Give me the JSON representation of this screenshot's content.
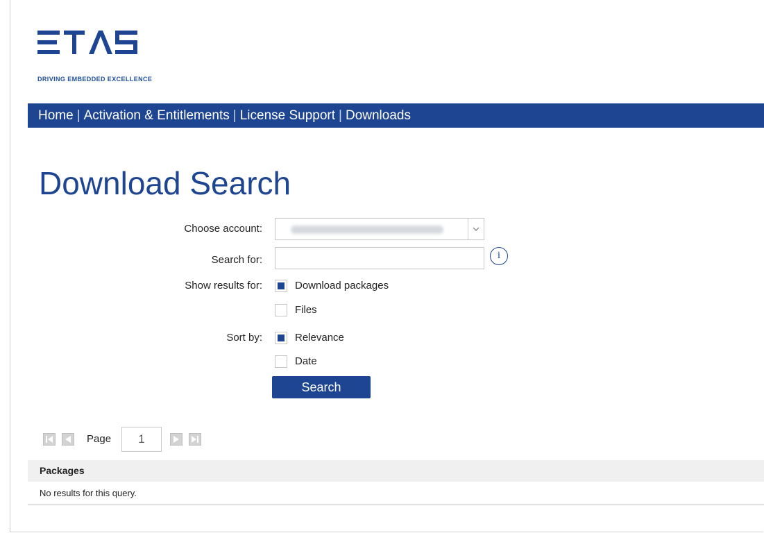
{
  "brand": {
    "logo_text": "ETAS",
    "tagline": "DRIVING EMBEDDED EXCELLENCE",
    "color": "#1d4592"
  },
  "nav": {
    "items": [
      {
        "label": "Home"
      },
      {
        "label": "Activation & Entitlements"
      },
      {
        "label": "License Support"
      },
      {
        "label": "Downloads"
      }
    ],
    "separator": "|"
  },
  "page": {
    "title": "Download Search"
  },
  "form": {
    "account_label": "Choose account:",
    "account_value_obscured": true,
    "search_label": "Search for:",
    "search_value": "",
    "info_icon": "info-icon",
    "show_results_label": "Show results for:",
    "show_results_options": [
      {
        "label": "Download packages",
        "checked": true
      },
      {
        "label": "Files",
        "checked": false
      }
    ],
    "sort_label": "Sort by:",
    "sort_options": [
      {
        "label": "Relevance",
        "checked": true
      },
      {
        "label": "Date",
        "checked": false
      }
    ],
    "search_button": "Search"
  },
  "pagination": {
    "label": "Page",
    "current": "1",
    "icons": [
      "first-page-icon",
      "prev-page-icon",
      "next-page-icon",
      "last-page-icon"
    ]
  },
  "results": {
    "header": "Packages",
    "empty_message": "No results for this query."
  }
}
